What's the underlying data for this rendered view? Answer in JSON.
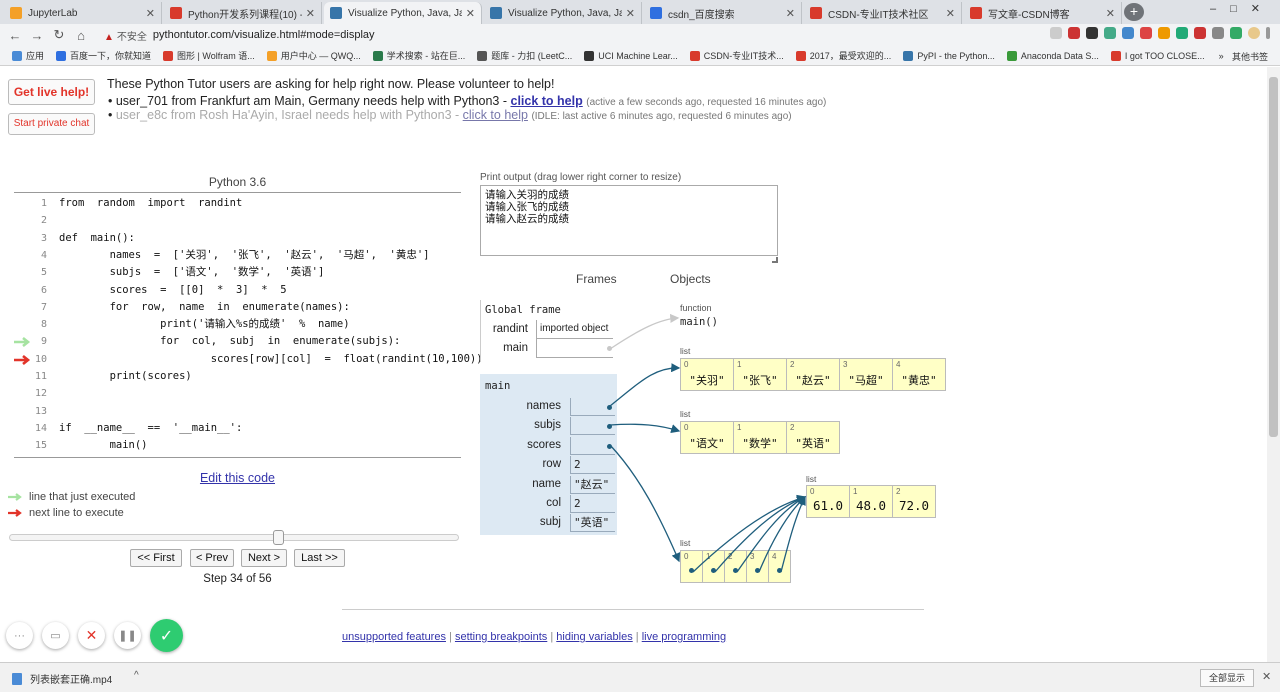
{
  "browser": {
    "tabs": [
      {
        "label": "JupyterLab",
        "color": "#f4a028"
      },
      {
        "label": "Python开发系列课程(10) - 那些...",
        "color": "#d83a2c"
      },
      {
        "label": "Visualize Python, Java, JavaScr...",
        "color": "#3775a9"
      },
      {
        "label": "Visualize Python, Java, JavaScr...",
        "color": "#3775a9"
      },
      {
        "label": "csdn_百度搜索",
        "color": "#2f6fe0"
      },
      {
        "label": "CSDN-专业IT技术社区",
        "color": "#d83a2c"
      },
      {
        "label": "写文章-CSDN博客",
        "color": "#d83a2c"
      }
    ],
    "insecure_label": "不安全",
    "url": "pythontutor.com/visualize.html#mode=display",
    "bookmarks": [
      "应用",
      "百度一下，你就知道",
      "图形 | Wolfram 语...",
      "用户中心 — QWQ...",
      "学术搜索 - 站在巨...",
      "题库 - 力扣 (LeetC...",
      "UCI Machine Lear...",
      "CSDN-专业IT技术...",
      "2017，最受欢迎的...",
      "PyPI - the Python...",
      "Anaconda Data S...",
      "I got TOO CLOSE..."
    ],
    "bookmark_more": "»",
    "other_bookmarks": "其他书签"
  },
  "help": {
    "live_button": "Get live help!",
    "private_button": "Start private chat",
    "heading": "These Python Tutor users are asking for help right now. Please volunteer to help!",
    "requests": [
      {
        "who": "user_701 from Frankfurt am Main, Germany needs help with Python3 -",
        "link": "click to help",
        "meta": "(active a few seconds ago, requested 16 minutes ago)"
      },
      {
        "who": "user_e8c from Rosh Ha'Ayin, Israel needs help with Python3 -",
        "link": "click to help",
        "meta": "(IDLE: last active 6 minutes ago, requested 6 minutes ago)"
      }
    ]
  },
  "code": {
    "version": "Python 3.6",
    "lines": [
      {
        "n": "1",
        "t": "from  random  import  randint"
      },
      {
        "n": "2",
        "t": ""
      },
      {
        "n": "3",
        "t": "def  main():"
      },
      {
        "n": "4",
        "t": "        names  =  ['关羽',  '张飞',  '赵云',  '马超',  '黄忠']"
      },
      {
        "n": "5",
        "t": "        subjs  =  ['语文',  '数学',  '英语']"
      },
      {
        "n": "6",
        "t": "        scores  =  [[0]  *  3]  *  5"
      },
      {
        "n": "7",
        "t": "        for  row,  name  in  enumerate(names):"
      },
      {
        "n": "8",
        "t": "                print('请输入%s的成绩'  %  name)"
      },
      {
        "n": "9",
        "t": "                for  col,  subj  in  enumerate(subjs):"
      },
      {
        "n": "10",
        "t": "                        scores[row][col]  =  float(randint(10,100))"
      },
      {
        "n": "11",
        "t": "        print(scores)"
      },
      {
        "n": "12",
        "t": ""
      },
      {
        "n": "13",
        "t": ""
      },
      {
        "n": "14",
        "t": "if  __name__  ==  '__main__':"
      },
      {
        "n": "15",
        "t": "        main()"
      }
    ],
    "edit_link": "Edit this code",
    "legend_green": "line that just executed",
    "legend_red": "next line to execute",
    "colors": {
      "green": "#a6e3a1",
      "red": "#e2342a"
    }
  },
  "nav": {
    "first": "<< First",
    "prev": "< Prev",
    "next": "Next >",
    "last": "Last >>",
    "step": "Step 34 of 56",
    "progress": 0.6
  },
  "output": {
    "label": "Print output (drag lower right corner to resize)",
    "text": "请输入关羽的成绩\n请输入张飞的成绩\n请输入赵云的成绩"
  },
  "viz": {
    "frames_heading": "Frames",
    "objects_heading": "Objects",
    "global_frame": {
      "title": "Global frame",
      "randint_name": "randint",
      "randint_value": "imported object",
      "main_name": "main"
    },
    "function_obj": {
      "label": "function",
      "name": "main()"
    },
    "main_frame": {
      "title": "main",
      "vars": [
        {
          "name": "names",
          "value": ""
        },
        {
          "name": "subjs",
          "value": ""
        },
        {
          "name": "scores",
          "value": ""
        },
        {
          "name": "row",
          "value": "2"
        },
        {
          "name": "name",
          "value": "\"赵云\""
        },
        {
          "name": "col",
          "value": "2"
        },
        {
          "name": "subj",
          "value": "\"英语\""
        }
      ]
    },
    "list_label": "list",
    "names_list": [
      "\"关羽\"",
      "\"张飞\"",
      "\"赵云\"",
      "\"马超\"",
      "\"黄忠\""
    ],
    "subjs_list": [
      "\"语文\"",
      "\"数学\"",
      "\"英语\""
    ],
    "row_list": [
      "61.0",
      "48.0",
      "72.0"
    ],
    "scores_indices": [
      "0",
      "1",
      "2",
      "3",
      "4"
    ],
    "indices": [
      "0",
      "1",
      "2",
      "3",
      "4"
    ]
  },
  "footer": {
    "links": [
      "unsupported features",
      "setting breakpoints",
      "hiding variables",
      "live programming"
    ],
    "sep": "|"
  },
  "download": {
    "file": "列表嵌套正确.mp4",
    "show_all": "全部显示",
    "caret": "^",
    "close": "✕"
  }
}
